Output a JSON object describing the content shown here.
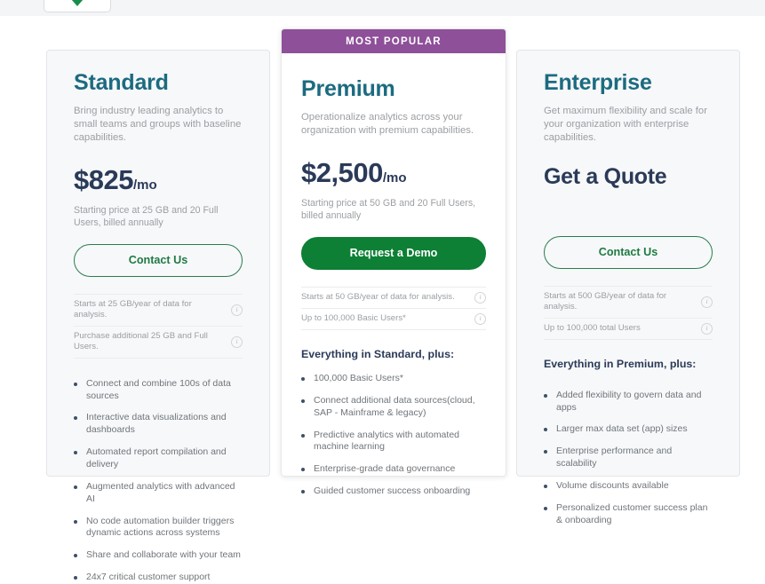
{
  "page": {
    "toggle_stub": {
      "icon": "chevron-down-icon"
    }
  },
  "plans": [
    {
      "id": "standard",
      "name": "Standard",
      "description": "Bring industry leading analytics to small teams and groups with baseline capabilities.",
      "price": "$825",
      "price_unit": "/mo",
      "price_note": "Starting price at 25 GB and 20 Full Users, billed annually",
      "cta_label": "Contact Us",
      "cta_style": "outline",
      "info_rows": [
        {
          "text": "Starts at 25 GB/year of data for analysis.",
          "icon": "info-circle-icon"
        },
        {
          "text": "Purchase additional 25 GB and Full Users.",
          "icon": "info-circle-icon"
        }
      ],
      "features_heading": "",
      "features": [
        "Connect and combine 100s of data sources",
        "Interactive data visualizations and dashboards",
        "Automated report compilation and delivery",
        "Augmented analytics with advanced AI",
        "No code automation builder triggers dynamic actions across systems",
        "Share and collaborate with your team",
        "24x7 critical customer support"
      ]
    },
    {
      "id": "premium",
      "badge": "MOST POPULAR",
      "name": "Premium",
      "description": "Operationalize analytics across your organization with premium capabilities.",
      "price": "$2,500",
      "price_unit": "/mo",
      "price_note": "Starting price at 50 GB and 20 Full Users, billed annually",
      "cta_label": "Request a Demo",
      "cta_style": "solid",
      "info_rows": [
        {
          "text": "Starts at 50 GB/year of data for analysis.",
          "icon": "info-circle-icon"
        },
        {
          "text": "Up to 100,000 Basic Users*",
          "icon": "info-circle-icon"
        }
      ],
      "features_heading": "Everything in Standard, plus:",
      "features": [
        "100,000 Basic Users*",
        "Connect additional data sources(cloud, SAP - Mainframe & legacy)",
        "Predictive analytics with automated machine learning",
        "Enterprise-grade data governance",
        "Guided customer success onboarding"
      ]
    },
    {
      "id": "enterprise",
      "name": "Enterprise",
      "description": "Get maximum flexibility and scale for your organization with enterprise capabilities.",
      "price": "Get a Quote",
      "price_unit": "",
      "price_note": "",
      "cta_label": "Contact Us",
      "cta_style": "outline",
      "info_rows": [
        {
          "text": "Starts at 500 GB/year of data for analysis.",
          "icon": "info-circle-icon"
        },
        {
          "text": "Up to 100,000 total Users",
          "icon": "info-circle-icon"
        }
      ],
      "features_heading": "Everything in Premium, plus:",
      "features": [
        "Added flexibility to govern data and apps",
        "Larger max data set (app) sizes",
        "Enterprise performance and scalability",
        "Volume discounts available",
        "Personalized customer success plan & onboarding"
      ]
    }
  ],
  "colors": {
    "badge_purple": "#8e5099",
    "plan_name_teal": "#1c6b81",
    "price_navy": "#2a3a58",
    "cta_green": "#0d8035",
    "cta_outline_green": "#1f7a44",
    "card_side_bg": "#f7f8f9"
  }
}
